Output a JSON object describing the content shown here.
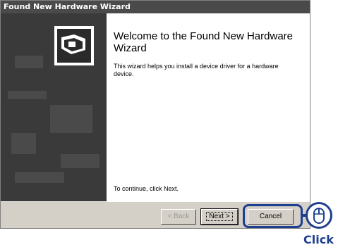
{
  "window": {
    "title": "Found New Hardware Wizard",
    "heading": "Welcome to the Found New Hardware Wizard",
    "description": "This wizard helps you install a device driver for a hardware device.",
    "continue_text": "To continue, click Next."
  },
  "buttons": {
    "back": "< Back",
    "next": "Next >",
    "cancel": "Cancel"
  },
  "callout": {
    "label": "Click",
    "icon": "mouse-icon",
    "accent": "#1e3f8f"
  }
}
